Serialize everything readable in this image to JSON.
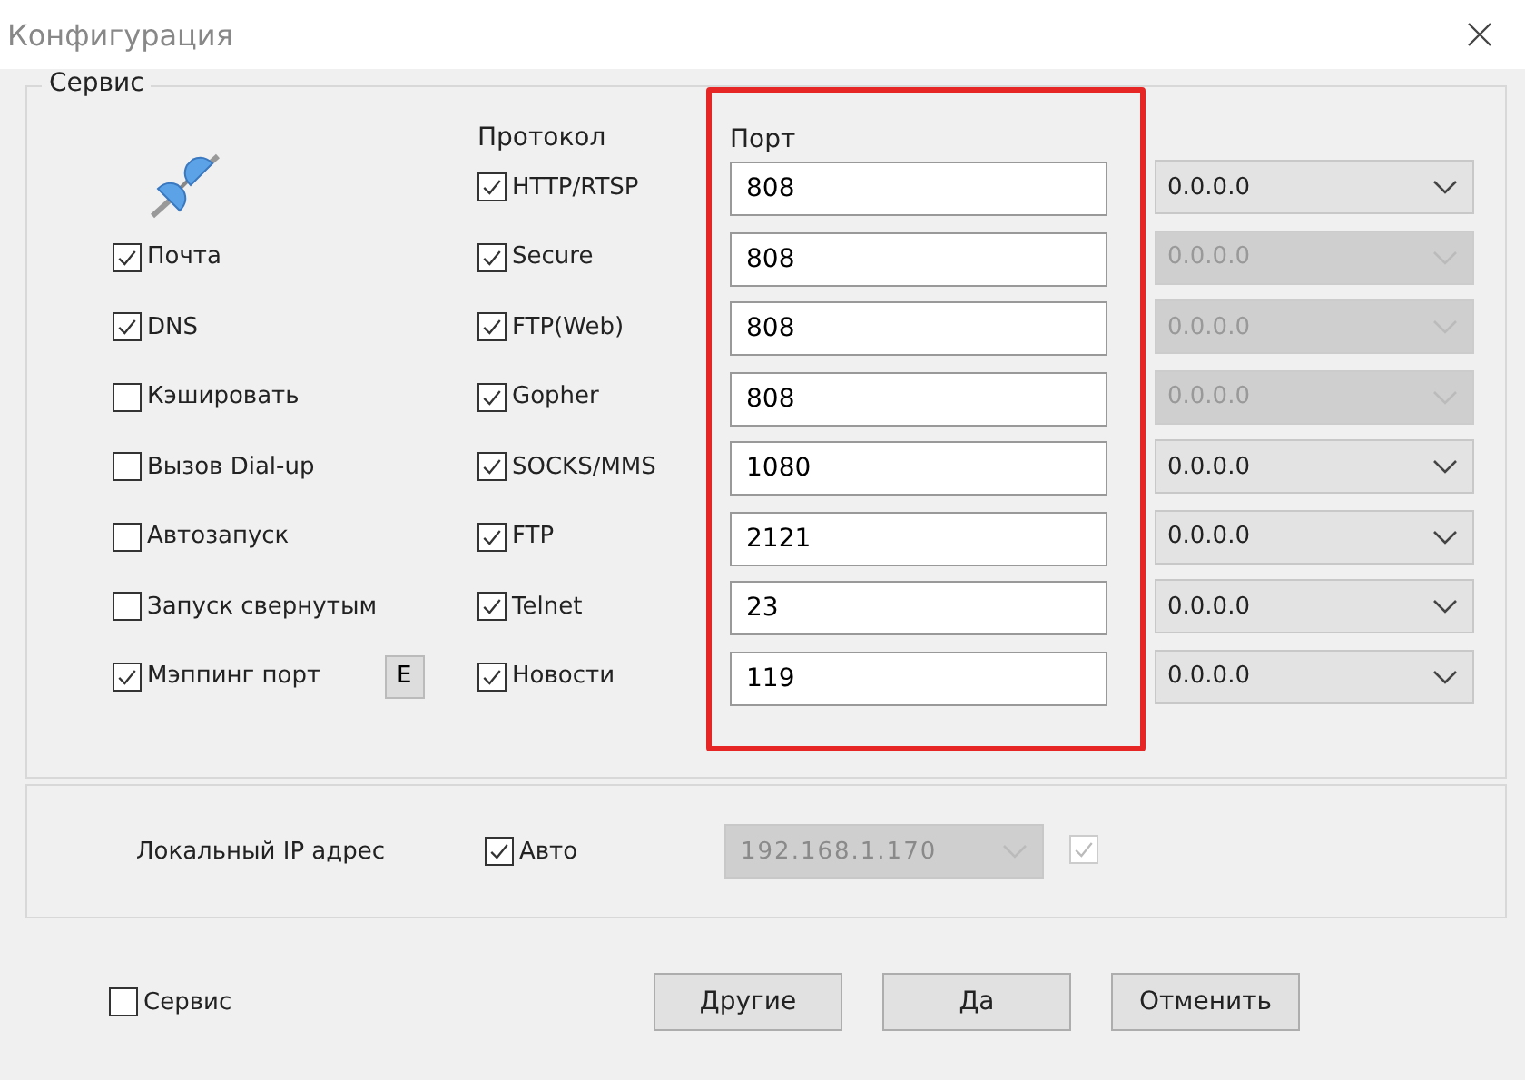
{
  "window": {
    "title": "Конфигурация"
  },
  "service_group": {
    "title": "Сервис",
    "options": [
      {
        "label": "Почта",
        "checked": true
      },
      {
        "label": "DNS",
        "checked": true
      },
      {
        "label": "Кэшировать",
        "checked": false
      },
      {
        "label": "Вызов Dial-up",
        "checked": false
      },
      {
        "label": "Автозапуск",
        "checked": false
      },
      {
        "label": "Запуск свернутым",
        "checked": false
      },
      {
        "label": "Мэппинг порт",
        "checked": true,
        "button": "E"
      }
    ],
    "protocol_header": "Протокол",
    "port_header": "Порт",
    "protocols": [
      {
        "label": "HTTP/RTSP",
        "checked": true,
        "port": "808",
        "address": "0.0.0.0",
        "disabled": false
      },
      {
        "label": "Secure",
        "checked": true,
        "port": "808",
        "address": "0.0.0.0",
        "disabled": true
      },
      {
        "label": "FTP(Web)",
        "checked": true,
        "port": "808",
        "address": "0.0.0.0",
        "disabled": true
      },
      {
        "label": "Gopher",
        "checked": true,
        "port": "808",
        "address": "0.0.0.0",
        "disabled": true
      },
      {
        "label": "SOCKS/MMS",
        "checked": true,
        "port": "1080",
        "address": "0.0.0.0",
        "disabled": false
      },
      {
        "label": "FTP",
        "checked": true,
        "port": "2121",
        "address": "0.0.0.0",
        "disabled": false
      },
      {
        "label": "Telnet",
        "checked": true,
        "port": "23",
        "address": "0.0.0.0",
        "disabled": false
      },
      {
        "label": "Новости",
        "checked": true,
        "port": "119",
        "address": "0.0.0.0",
        "disabled": false
      }
    ]
  },
  "local_ip": {
    "label": "Локальный IP адрес",
    "auto": {
      "label": "Авто",
      "checked": true
    },
    "address": "192.168.1.170",
    "disabled": true,
    "confirm_checked": true
  },
  "footer": {
    "service": {
      "label": "Сервис",
      "checked": false
    },
    "buttons": [
      "Другие",
      "Да",
      "Отменить"
    ]
  }
}
